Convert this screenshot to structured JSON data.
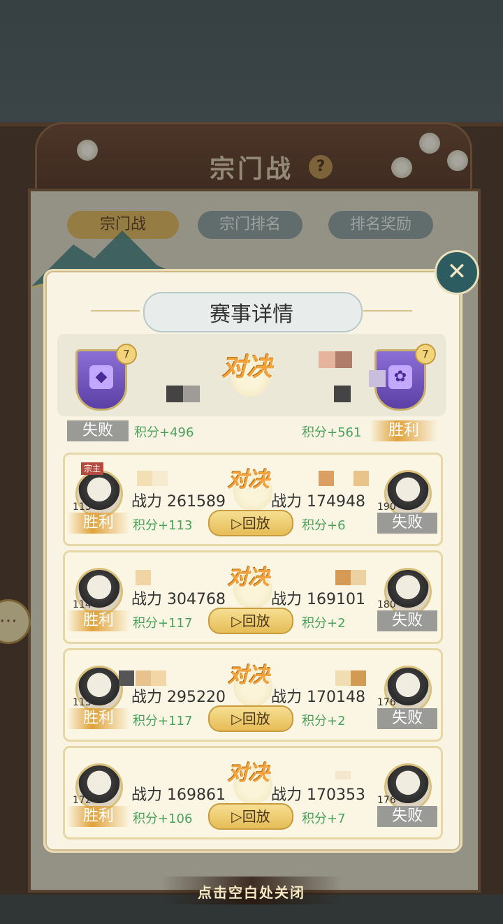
{
  "background": {
    "title": "宗门战",
    "help_icon": "?",
    "tabs": [
      {
        "label": "宗门战"
      },
      {
        "label": "宗门排名"
      },
      {
        "label": "排名奖励"
      }
    ],
    "chat_icon": "chat-bubble-icon"
  },
  "modal": {
    "title": "赛事详情",
    "close_icon": "close-x-icon",
    "vs_text": "对决",
    "summary": {
      "left": {
        "level": "7",
        "result": "失败",
        "score": "积分+496"
      },
      "right": {
        "level": "7",
        "result": "胜利",
        "score": "积分+561"
      }
    },
    "matches": [
      {
        "left": {
          "level": "113",
          "power": "战力 261589",
          "score": "积分+113",
          "result": "胜利",
          "tag": "宗主"
        },
        "right": {
          "level": "190",
          "power": "战力 174948",
          "score": "积分+6",
          "result": "失败"
        },
        "replay": "回放"
      },
      {
        "left": {
          "level": "114",
          "power": "战力 304768",
          "score": "积分+117",
          "result": "胜利"
        },
        "right": {
          "level": "180",
          "power": "战力 169101",
          "score": "积分+2",
          "result": "失败"
        },
        "replay": "回放"
      },
      {
        "left": {
          "level": "115",
          "power": "战力 295220",
          "score": "积分+117",
          "result": "胜利"
        },
        "right": {
          "level": "176",
          "power": "战力 170148",
          "score": "积分+2",
          "result": "失败"
        },
        "replay": "回放"
      },
      {
        "left": {
          "level": "172",
          "power": "战力 169861",
          "score": "积分+106",
          "result": "胜利"
        },
        "right": {
          "level": "176",
          "power": "战力 170353",
          "score": "积分+7",
          "result": "失败"
        },
        "replay": "回放"
      }
    ]
  },
  "footer": {
    "hint": "点击空白处关闭"
  },
  "colors": {
    "win": "#e0a23a",
    "lose": "#9a9a96",
    "score": "#4aa15a",
    "vs": "#f3a33c"
  }
}
